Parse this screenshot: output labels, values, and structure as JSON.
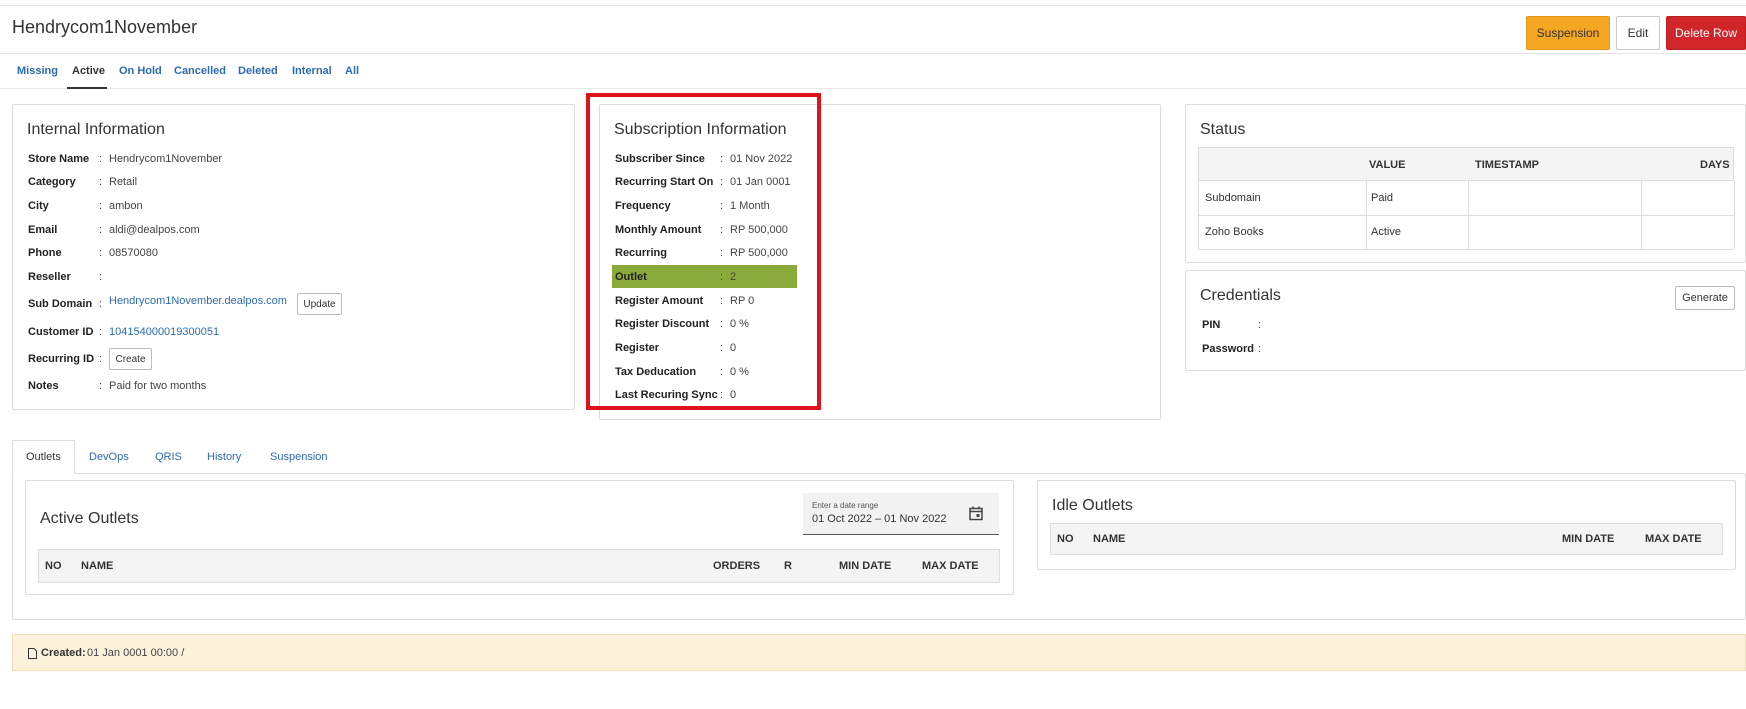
{
  "header": {
    "title": "Hendrycom1November",
    "buttons": {
      "suspension": "Suspension",
      "edit": "Edit",
      "delete_row": "Delete Row"
    }
  },
  "subnav": [
    "Missing",
    "Active",
    "On Hold",
    "Cancelled",
    "Deleted",
    "Internal",
    "All"
  ],
  "internal": {
    "title": "Internal Information",
    "rows": [
      {
        "label": "Store Name",
        "value": "Hendrycom1November"
      },
      {
        "label": "Category",
        "value": "Retail"
      },
      {
        "label": "City",
        "value": "ambon"
      },
      {
        "label": "Email",
        "value": "aldi@dealpos.com"
      },
      {
        "label": "Phone",
        "value": "08570080"
      },
      {
        "label": "Reseller",
        "value": ""
      },
      {
        "label": "Sub Domain",
        "value": "Hendrycom1November.dealpos.com"
      },
      {
        "label": "Customer ID",
        "value": "104154000019300051"
      },
      {
        "label": "Recurring ID",
        "value": ""
      },
      {
        "label": "Notes",
        "value": "Paid for two months"
      }
    ],
    "update_button": "Update",
    "create_button": "Create"
  },
  "subscription": {
    "title": "Subscription Information",
    "rows": [
      {
        "label": "Subscriber Since",
        "value": "01 Nov 2022"
      },
      {
        "label": "Recurring Start On",
        "value": "01 Jan 0001"
      },
      {
        "label": "Frequency",
        "value": "1 Month"
      },
      {
        "label": "Monthly Amount",
        "value": "RP 500,000"
      },
      {
        "label": "Recurring",
        "value": "RP 500,000"
      },
      {
        "label": "Outlet",
        "value": "2"
      },
      {
        "label": "Register Amount",
        "value": "RP 0"
      },
      {
        "label": "Register Discount",
        "value": "0 %"
      },
      {
        "label": "Register",
        "value": "0"
      },
      {
        "label": "Tax Deducation",
        "value": "0 %"
      },
      {
        "label": "Last Recuring Sync",
        "value": "0"
      }
    ],
    "highlight_color": "#8aab3c"
  },
  "status": {
    "title": "Status",
    "columns": [
      "",
      "VALUE",
      "TIMESTAMP",
      "DAYS"
    ],
    "rows": [
      {
        "name": "Subdomain",
        "value": "Paid"
      },
      {
        "name": "Zoho Books",
        "value": "Active"
      }
    ]
  },
  "credentials": {
    "title": "Credentials",
    "generate_button": "Generate",
    "rows": [
      {
        "label": "PIN"
      },
      {
        "label": "Password"
      }
    ]
  },
  "tabs": [
    "Outlets",
    "DevOps",
    "QRIS",
    "History",
    "Suspension"
  ],
  "active_outlets": {
    "title": "Active Outlets",
    "date_label": "Enter a date range",
    "date_value": "01 Oct 2022 – 01 Nov 2022",
    "columns": [
      "NO",
      "NAME",
      "ORDERS",
      "R",
      "MIN DATE",
      "MAX DATE"
    ]
  },
  "idle_outlets": {
    "title": "Idle Outlets",
    "columns": [
      "NO",
      "NAME",
      "MIN DATE",
      "MAX DATE"
    ]
  },
  "footer": {
    "created_label": "Created:",
    "created_value": "01 Jan 0001 00:00 /"
  },
  "colors": {
    "accent_blue": "#2b6cb0",
    "warning": "#f5a623",
    "danger": "#d0262a",
    "annotation_red": "#e0131b"
  }
}
